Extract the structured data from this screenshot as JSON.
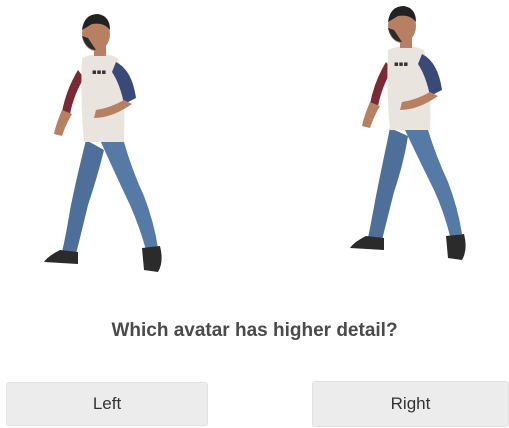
{
  "avatars": {
    "left": {
      "icon": "avatar-figure-left-icon"
    },
    "right": {
      "icon": "avatar-figure-right-icon"
    }
  },
  "question": {
    "text": "Which avatar has higher detail?"
  },
  "buttons": {
    "left_label": "Left",
    "right_label": "Right"
  },
  "colors": {
    "button_bg": "#ececec",
    "question_text": "#4a4a4a",
    "jeans": "#4d6f9a",
    "shirt": "#e9e5de",
    "sleeve": "#3a4a78",
    "sleeve_red": "#7a2a36",
    "skin": "#b88062",
    "hair": "#222222",
    "shoe": "#2b2b2b"
  }
}
